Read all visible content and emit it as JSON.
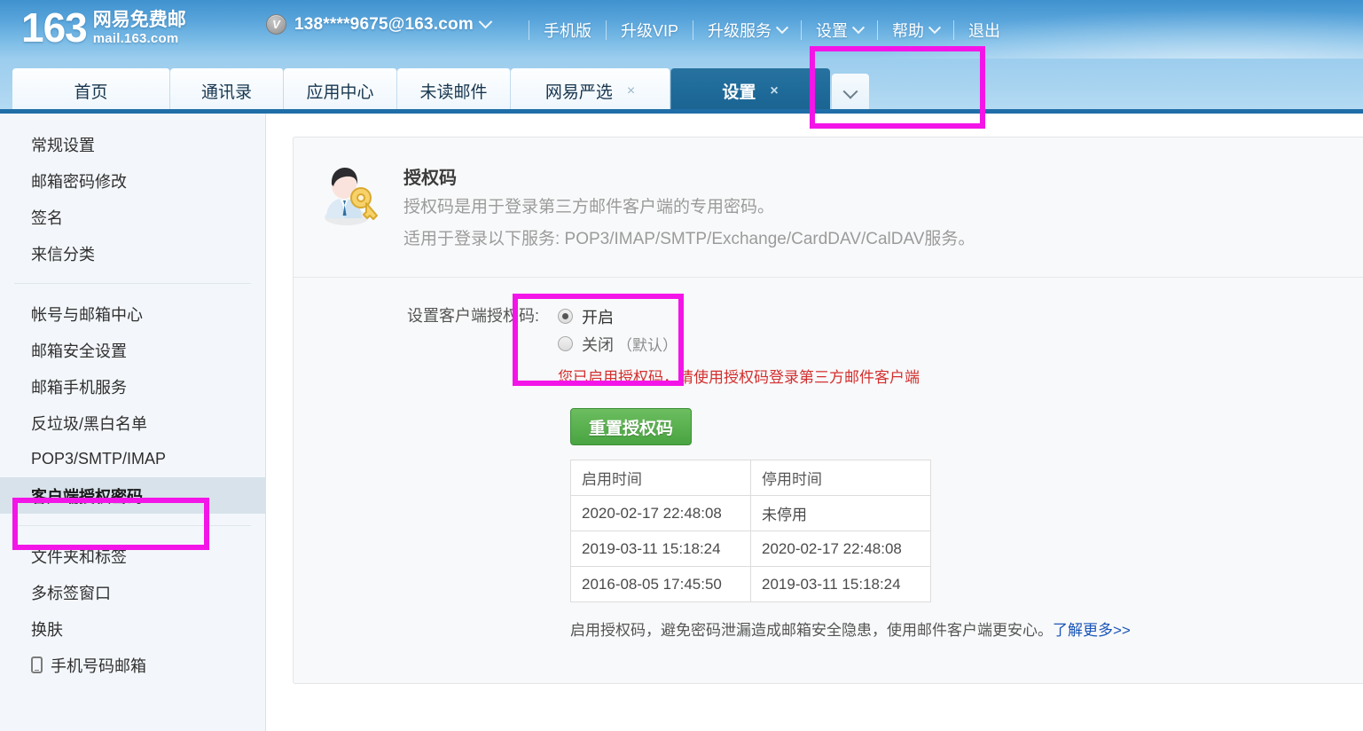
{
  "brand": {
    "number": "163",
    "name_cn": "网易免费邮",
    "domain": "mail.163.com"
  },
  "header": {
    "vip_badge": "V",
    "account_email": "138****9675@163.com",
    "nav": [
      {
        "label": "手机版",
        "caret": false
      },
      {
        "label": "升级VIP",
        "caret": false
      },
      {
        "label": "升级服务",
        "caret": true
      },
      {
        "label": "设置",
        "caret": true
      },
      {
        "label": "帮助",
        "caret": true
      },
      {
        "label": "退出",
        "caret": false
      }
    ]
  },
  "tabs": {
    "items": [
      {
        "label": "首页",
        "closable": false,
        "active": false
      },
      {
        "label": "通讯录",
        "closable": false,
        "active": false
      },
      {
        "label": "应用中心",
        "closable": false,
        "active": false
      },
      {
        "label": "未读邮件",
        "closable": false,
        "active": false
      },
      {
        "label": "网易严选",
        "closable": true,
        "active": false
      },
      {
        "label": "设置",
        "closable": true,
        "active": true
      }
    ],
    "close_glyph": "×",
    "more_icon": "chevron-down-icon"
  },
  "sidebar": {
    "groups": [
      {
        "items": [
          {
            "label": "常规设置",
            "active": false
          },
          {
            "label": "邮箱密码修改",
            "active": false
          },
          {
            "label": "签名",
            "active": false
          },
          {
            "label": "来信分类",
            "active": false
          }
        ]
      },
      {
        "items": [
          {
            "label": "帐号与邮箱中心",
            "active": false
          },
          {
            "label": "邮箱安全设置",
            "active": false
          },
          {
            "label": "邮箱手机服务",
            "active": false
          },
          {
            "label": "反垃圾/黑白名单",
            "active": false
          },
          {
            "label": "POP3/SMTP/IMAP",
            "active": false
          },
          {
            "label": "客户端授权密码",
            "active": true
          }
        ]
      },
      {
        "items": [
          {
            "label": "文件夹和标签",
            "active": false
          },
          {
            "label": "多标签窗口",
            "active": false
          },
          {
            "label": "换肤",
            "active": false
          },
          {
            "label": "手机号码邮箱",
            "active": false,
            "icon": "phone-icon"
          }
        ]
      }
    ]
  },
  "main": {
    "icon": "person-with-key-icon",
    "title": "授权码",
    "desc_line1": "授权码是用于登录第三方邮件客户端的专用密码。",
    "desc_line2": "适用于登录以下服务: POP3/IMAP/SMTP/Exchange/CardDAV/CalDAV服务。",
    "field_label": "设置客户端授权码:",
    "radio_on_label": "开启",
    "radio_off_label": "关闭",
    "radio_off_suffix": "（默认）",
    "selected_radio": "on",
    "warning_text": "您已启用授权码，请使用授权码登录第三方邮件客户端",
    "reset_button": "重置授权码",
    "table": {
      "headers": [
        "启用时间",
        "停用时间"
      ],
      "rows": [
        [
          "2020-02-17 22:48:08",
          "未停用"
        ],
        [
          "2019-03-11 15:18:24",
          "2020-02-17 22:48:08"
        ],
        [
          "2016-08-05 17:45:50",
          "2019-03-11 15:18:24"
        ]
      ]
    },
    "footer_text": "启用授权码，避免密码泄漏造成邮箱安全隐患，使用邮件客户端更安心。",
    "footer_link": "了解更多>>"
  },
  "annotations": {
    "color": "#f315e8",
    "boxes": [
      "tab-settings",
      "radio-group",
      "sidebar-item-client-auth-password"
    ]
  }
}
